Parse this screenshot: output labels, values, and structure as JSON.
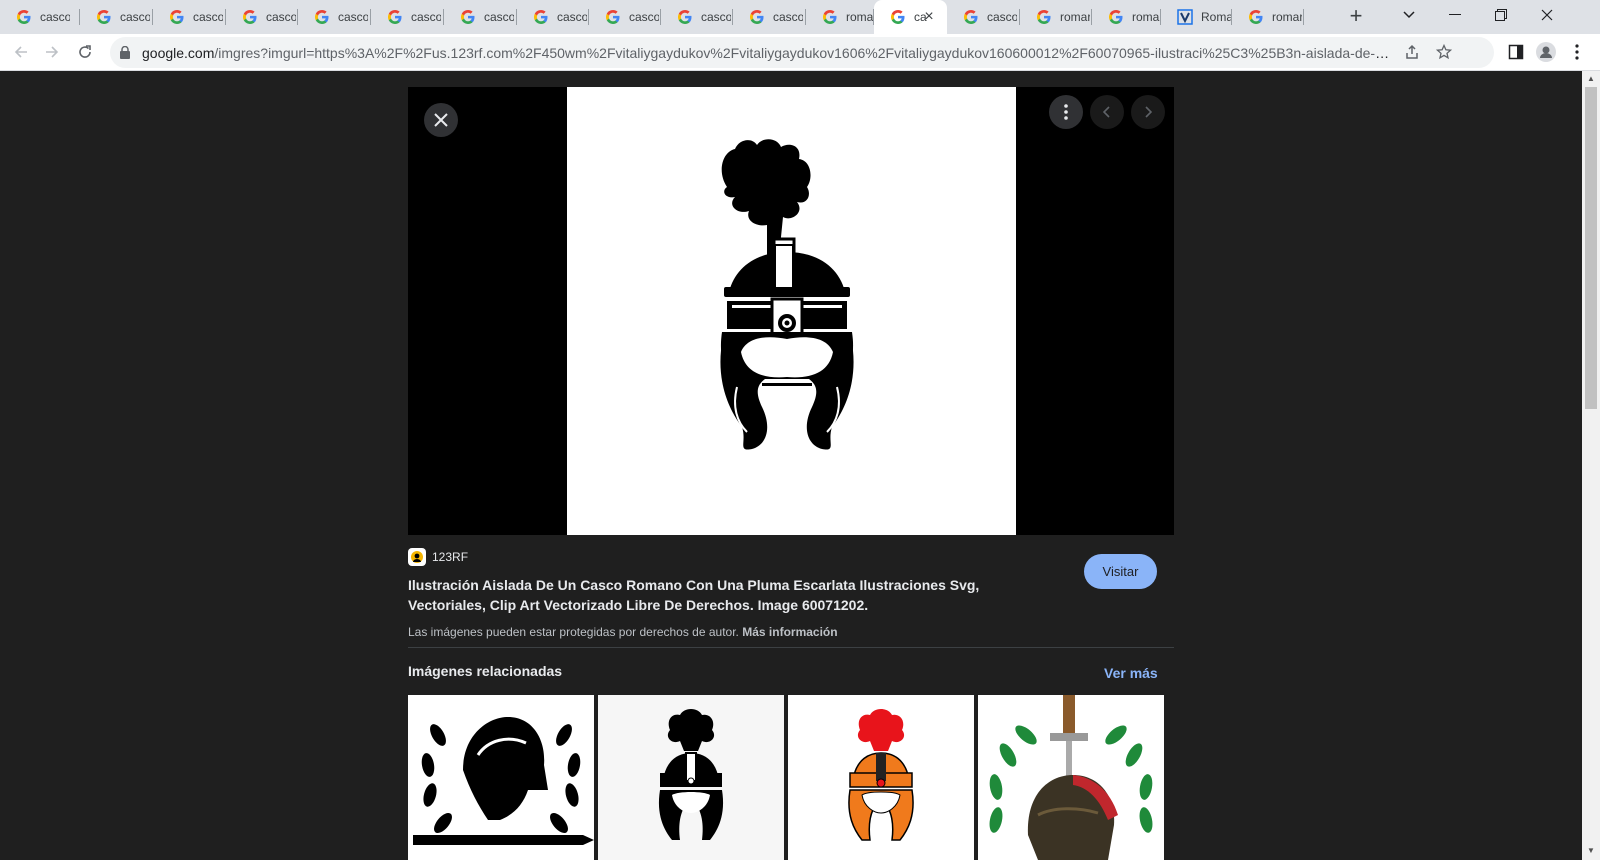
{
  "browser": {
    "tabs": [
      {
        "title": "casco",
        "favicon": "google-icon"
      },
      {
        "title": "casco",
        "favicon": "google-icon"
      },
      {
        "title": "casco",
        "favicon": "google-icon"
      },
      {
        "title": "casco",
        "favicon": "google-icon"
      },
      {
        "title": "casco",
        "favicon": "google-icon"
      },
      {
        "title": "casco",
        "favicon": "google-icon"
      },
      {
        "title": "casco",
        "favicon": "google-icon"
      },
      {
        "title": "casco",
        "favicon": "google-icon"
      },
      {
        "title": "casco",
        "favicon": "google-icon"
      },
      {
        "title": "casco",
        "favicon": "google-icon"
      },
      {
        "title": "casco",
        "favicon": "google-icon"
      },
      {
        "title": "romar",
        "favicon": "google-icon"
      },
      {
        "title": "ca",
        "favicon": "google-icon",
        "active": true
      },
      {
        "title": "casco",
        "favicon": "google-icon"
      },
      {
        "title": "romar",
        "favicon": "google-icon"
      },
      {
        "title": "romar",
        "favicon": "google-icon"
      },
      {
        "title": "Roma",
        "favicon": "v-icon"
      },
      {
        "title": "romar",
        "favicon": "google-icon"
      }
    ],
    "url_host": "google.com",
    "url_path": "/imgres?imgurl=https%3A%2F%2Fus.123rf.com%2F450wm%2Fvitaliygaydukov%2Fvitaliygaydukov1606%2Fvitaliygaydukov160600012%2F60070965-ilustraci%25C3%25B3n-aislada-de-un-casco-..."
  },
  "viewer": {
    "source_name": "123RF",
    "title": "Ilustración Aislada De Un Casco Romano Con Una Pluma Escarlata Ilustraciones Svg, Vectoriales, Clip Art Vectorizado Libre De Derechos. Image 60071202.",
    "visit_label": "Visitar",
    "copyright_text": "Las imágenes pueden estar protegidas por derechos de autor.",
    "more_info_label": "Más información",
    "related_heading": "Imágenes relacionadas",
    "see_more_label": "Ver más"
  },
  "colors": {
    "page_bg": "#1f1f1f",
    "accent": "#8ab4f8"
  }
}
